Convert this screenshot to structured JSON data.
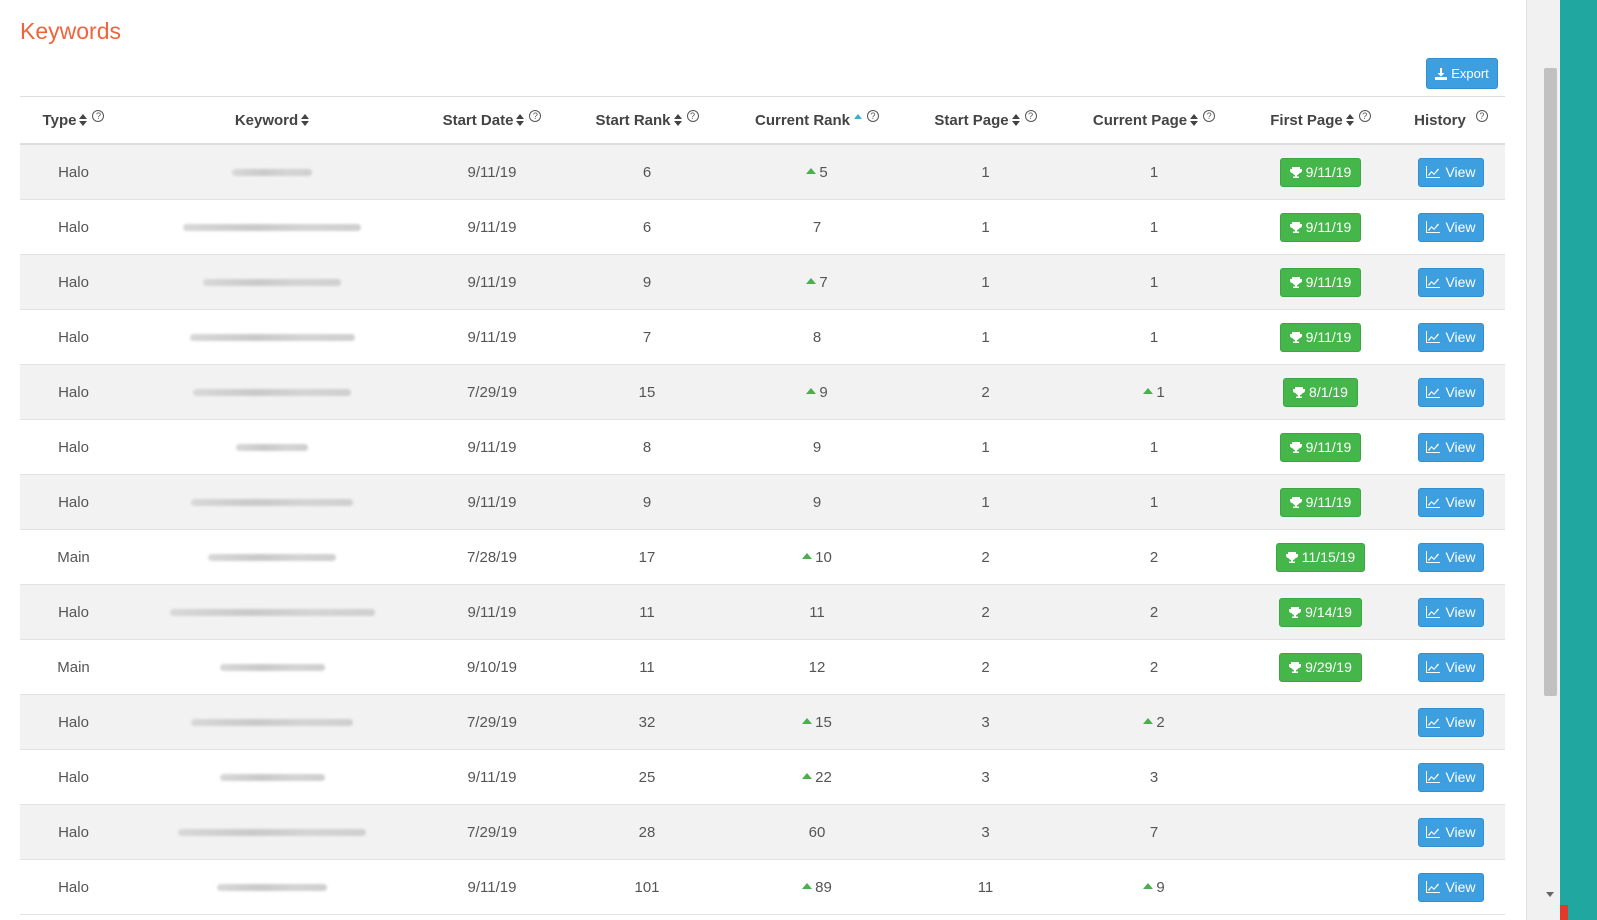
{
  "page": {
    "title": "Keywords",
    "export_label": "Export"
  },
  "table": {
    "headers": {
      "type": "Type",
      "keyword": "Keyword",
      "start_date": "Start Date",
      "start_rank": "Start Rank",
      "current_rank": "Current Rank",
      "start_page": "Start Page",
      "current_page": "Current Page",
      "first_page": "First Page",
      "history": "History",
      "help_glyph": "?"
    },
    "view_label": "View",
    "rows": [
      {
        "type": "Halo",
        "start_date": "9/11/19",
        "start_rank": "6",
        "current_rank": "5",
        "rank_up": true,
        "start_page": "1",
        "current_page": "1",
        "page_up": false,
        "first_page": "9/11/19"
      },
      {
        "type": "Halo",
        "start_date": "9/11/19",
        "start_rank": "6",
        "current_rank": "7",
        "rank_up": false,
        "start_page": "1",
        "current_page": "1",
        "page_up": false,
        "first_page": "9/11/19"
      },
      {
        "type": "Halo",
        "start_date": "9/11/19",
        "start_rank": "9",
        "current_rank": "7",
        "rank_up": true,
        "start_page": "1",
        "current_page": "1",
        "page_up": false,
        "first_page": "9/11/19"
      },
      {
        "type": "Halo",
        "start_date": "9/11/19",
        "start_rank": "7",
        "current_rank": "8",
        "rank_up": false,
        "start_page": "1",
        "current_page": "1",
        "page_up": false,
        "first_page": "9/11/19"
      },
      {
        "type": "Halo",
        "start_date": "7/29/19",
        "start_rank": "15",
        "current_rank": "9",
        "rank_up": true,
        "start_page": "2",
        "current_page": "1",
        "page_up": true,
        "first_page": "8/1/19"
      },
      {
        "type": "Halo",
        "start_date": "9/11/19",
        "start_rank": "8",
        "current_rank": "9",
        "rank_up": false,
        "start_page": "1",
        "current_page": "1",
        "page_up": false,
        "first_page": "9/11/19"
      },
      {
        "type": "Halo",
        "start_date": "9/11/19",
        "start_rank": "9",
        "current_rank": "9",
        "rank_up": false,
        "start_page": "1",
        "current_page": "1",
        "page_up": false,
        "first_page": "9/11/19"
      },
      {
        "type": "Main",
        "start_date": "7/28/19",
        "start_rank": "17",
        "current_rank": "10",
        "rank_up": true,
        "start_page": "2",
        "current_page": "2",
        "page_up": false,
        "first_page": "11/15/19"
      },
      {
        "type": "Halo",
        "start_date": "9/11/19",
        "start_rank": "11",
        "current_rank": "11",
        "rank_up": false,
        "start_page": "2",
        "current_page": "2",
        "page_up": false,
        "first_page": "9/14/19"
      },
      {
        "type": "Main",
        "start_date": "9/10/19",
        "start_rank": "11",
        "current_rank": "12",
        "rank_up": false,
        "start_page": "2",
        "current_page": "2",
        "page_up": false,
        "first_page": "9/29/19"
      },
      {
        "type": "Halo",
        "start_date": "7/29/19",
        "start_rank": "32",
        "current_rank": "15",
        "rank_up": true,
        "start_page": "3",
        "current_page": "2",
        "page_up": true,
        "first_page": ""
      },
      {
        "type": "Halo",
        "start_date": "9/11/19",
        "start_rank": "25",
        "current_rank": "22",
        "rank_up": true,
        "start_page": "3",
        "current_page": "3",
        "page_up": false,
        "first_page": ""
      },
      {
        "type": "Halo",
        "start_date": "7/29/19",
        "start_rank": "28",
        "current_rank": "60",
        "rank_up": false,
        "start_page": "3",
        "current_page": "7",
        "page_up": false,
        "first_page": ""
      },
      {
        "type": "Halo",
        "start_date": "9/11/19",
        "start_rank": "101",
        "current_rank": "89",
        "rank_up": true,
        "start_page": "11",
        "current_page": "9",
        "page_up": true,
        "first_page": ""
      }
    ]
  },
  "colors": {
    "title": "#f0643c",
    "button": "#3d9ee0",
    "badge": "#45b649",
    "trend_up": "#4cae4c"
  },
  "icons": {
    "export": "download-icon",
    "first_page": "trophy-icon",
    "view": "line-chart-icon",
    "help": "question-circle-icon"
  }
}
